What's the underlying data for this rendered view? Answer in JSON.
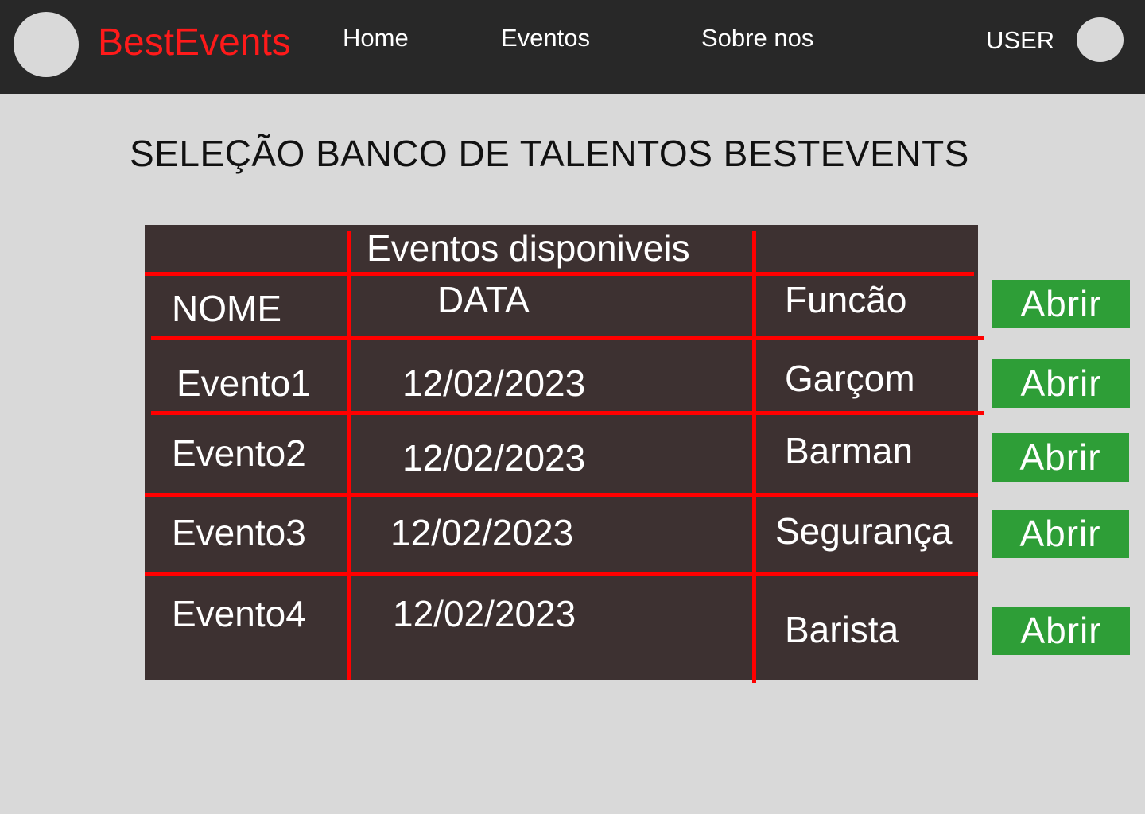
{
  "brand": {
    "name": "BestEvents",
    "color": "#ff1a1a"
  },
  "nav": {
    "links": [
      {
        "label": "Home"
      },
      {
        "label": "Eventos"
      },
      {
        "label": "Sobre nos"
      }
    ],
    "user_label": "USER"
  },
  "page": {
    "title": "SELEÇÃO BANCO DE TALENTOS BESTEVENTS"
  },
  "table": {
    "caption": "Eventos disponiveis",
    "headers": {
      "nome": "NOME",
      "data": "DATA",
      "funcao": "Funcão"
    },
    "rows": [
      {
        "nome": "Evento1",
        "data": "12/02/2023",
        "funcao": "Garçom"
      },
      {
        "nome": "Evento2",
        "data": "12/02/2023",
        "funcao": "Barman"
      },
      {
        "nome": "Evento3",
        "data": "12/02/2023",
        "funcao": "Segurança"
      },
      {
        "nome": "Evento4",
        "data": "12/02/2023",
        "funcao": "Barista"
      }
    ]
  },
  "actions": {
    "open_label": "Abrir"
  },
  "colors": {
    "navbar": "#282828",
    "background": "#d9d9d9",
    "table": "#3d3131",
    "grid_lines": "#ff0000",
    "button": "#2e9e37"
  }
}
